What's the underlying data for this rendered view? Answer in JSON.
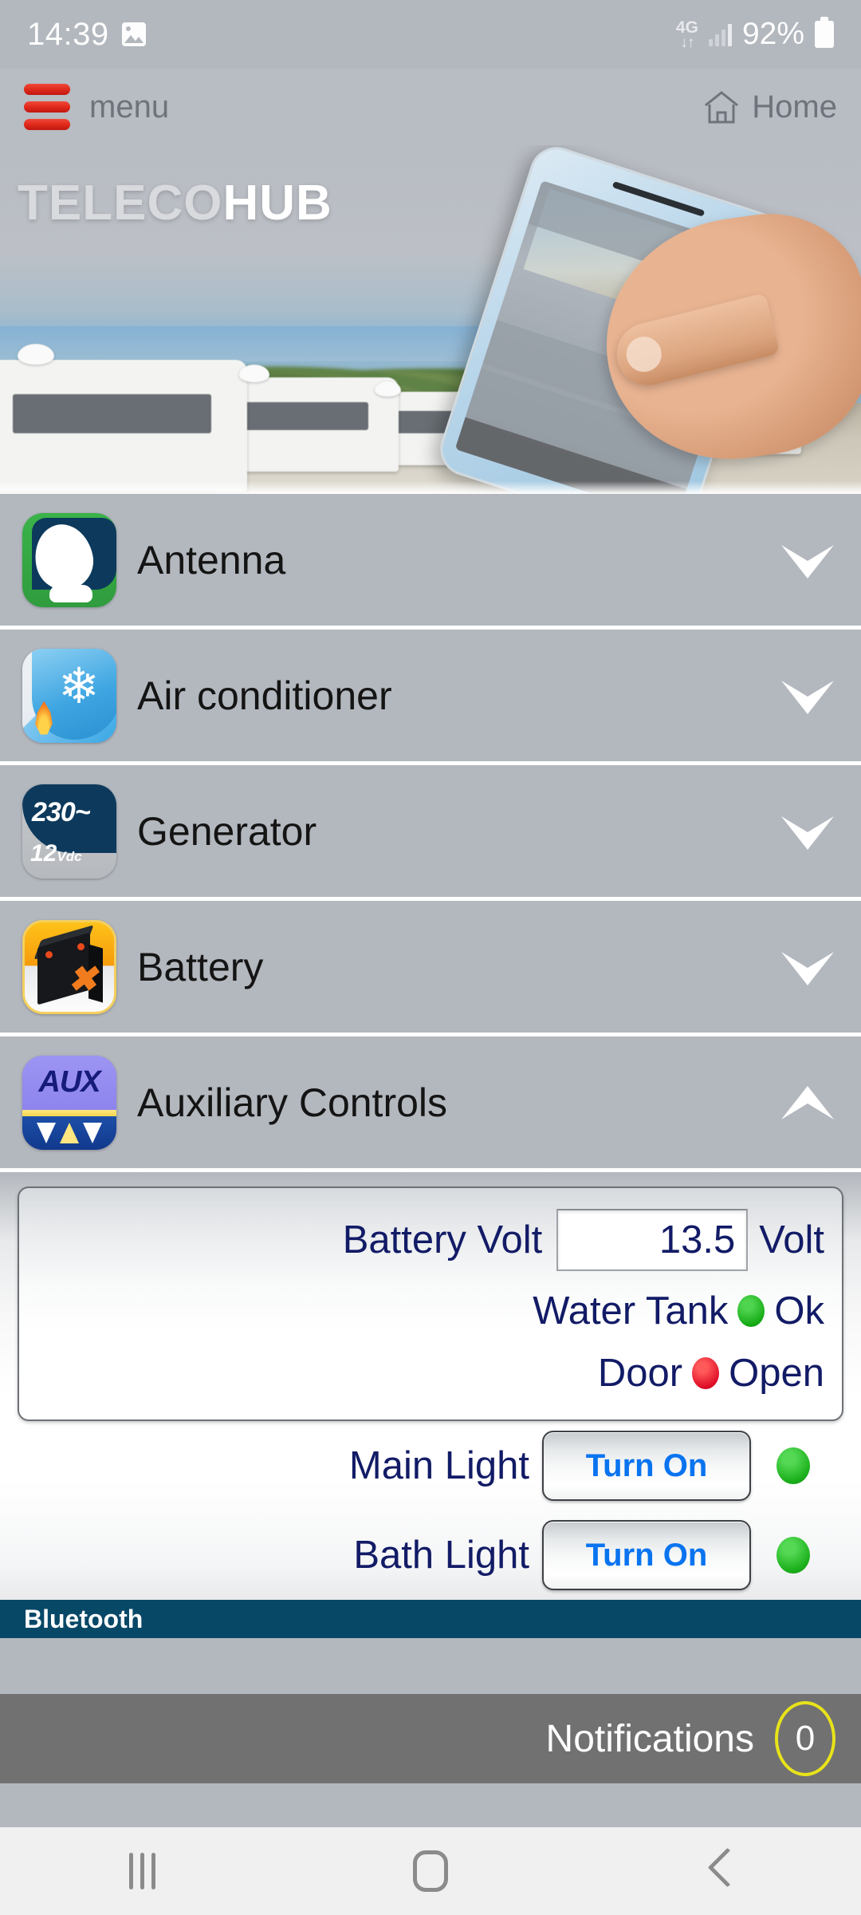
{
  "status_bar": {
    "time": "14:39",
    "gallery_icon": "image-icon",
    "network_type": "4G",
    "network_arrows": "↓↑",
    "signal_icon": "signal-bars-icon",
    "battery_percent": "92%",
    "battery_icon": "battery-full-icon"
  },
  "app_bar": {
    "menu_icon": "hamburger-menu-icon",
    "menu_label": "menu",
    "home_icon": "house-icon",
    "home_label": "Home"
  },
  "banner": {
    "logo_part1": "TELECO",
    "logo_part2": "HUB",
    "alt": "Motorhome campsite with hand holding smartphone running the Teleco Hub app"
  },
  "list": {
    "items": [
      {
        "label": "Antenna",
        "icon": "satellite-dish-icon",
        "chevron": "chevron-down-icon",
        "expanded": false
      },
      {
        "label": "Air conditioner",
        "icon": "snowflake-flame-icon",
        "chevron": "chevron-down-icon",
        "expanded": false
      },
      {
        "label": "Generator",
        "icon": "generator-230v-icon",
        "chevron": "chevron-down-icon",
        "expanded": false
      },
      {
        "label": "Battery",
        "icon": "battery-block-icon",
        "chevron": "chevron-down-icon",
        "expanded": false
      },
      {
        "label": "Auxiliary Controls",
        "icon": "aux-arrows-icon",
        "chevron": "chevron-up-icon",
        "expanded": true
      }
    ],
    "generator_icon_text": {
      "ac": "230~",
      "dc_value": "12",
      "dc_unit": "Vdc"
    },
    "aux_icon_text": "AUX"
  },
  "aux_panel": {
    "battery_volt": {
      "label": "Battery Volt",
      "value": "13.5",
      "unit": "Volt"
    },
    "water_tank": {
      "label": "Water Tank",
      "status": "Ok",
      "status_color": "#17ab17",
      "indicator": "status-dot-green"
    },
    "door": {
      "label": "Door",
      "status": "Open",
      "status_color": "#e00f28",
      "indicator": "status-dot-red"
    },
    "lights": [
      {
        "label": "Main Light",
        "button": "Turn On",
        "indicator": "status-dot-green",
        "state_color": "#1cb01c"
      },
      {
        "label": "Bath Light",
        "button": "Turn On",
        "indicator": "status-dot-green",
        "state_color": "#1cb01c"
      }
    ]
  },
  "bluetooth_bar": {
    "label": "Bluetooth",
    "bar_color": "#084867"
  },
  "notifications": {
    "label": "Notifications",
    "count": "0",
    "badge_color": "#e8e31a",
    "bar_color": "#717171"
  },
  "nav_bar": {
    "recents_icon": "recents-icon",
    "home_icon": "home-square-icon",
    "back_icon": "back-chevron-icon"
  },
  "theme": {
    "page_bg": "#b3b7be",
    "accent_red": "#e02a1c",
    "text_navy": "#121b66",
    "link_blue": "#0a74f0"
  }
}
